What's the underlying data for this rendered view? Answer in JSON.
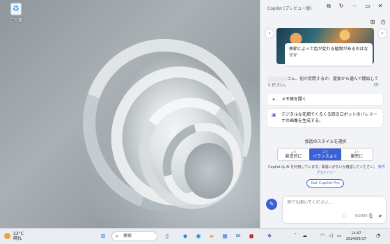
{
  "desktop": {
    "recycle_label": "ごみ箱"
  },
  "copilot": {
    "title": "Copilot (プレビュー版)",
    "hero_text": "季節によって色が変わる植物があるのはなぜか",
    "greeting": "さん、何か質問するか、提案から選んで開始してください。",
    "suggestions": [
      {
        "label": "メモ帳を開く"
      },
      {
        "label": "デジタルな花畑でくるくる回るロボットのバレリーナの画像を生成する。"
      }
    ],
    "style_title": "会話のスタイルを選択",
    "styles": [
      {
        "small": "より",
        "label": "創造的に"
      },
      {
        "small": "より",
        "label": "バランスよく"
      },
      {
        "small": "より",
        "label": "厳密に"
      }
    ],
    "note": "Copilot は AI を利用しています。間違いがないか確認してください。",
    "note_link1": "条件",
    "note_link2": "プライバシー",
    "get_pro": "Get Copilot Pro",
    "input_placeholder": "何でも聞いてください...",
    "counter": "0/2000"
  },
  "taskbar": {
    "temperature": "23°C",
    "weather": "晴れ",
    "search_placeholder": "検索",
    "time": "14:47",
    "date": "2024/05/17"
  }
}
